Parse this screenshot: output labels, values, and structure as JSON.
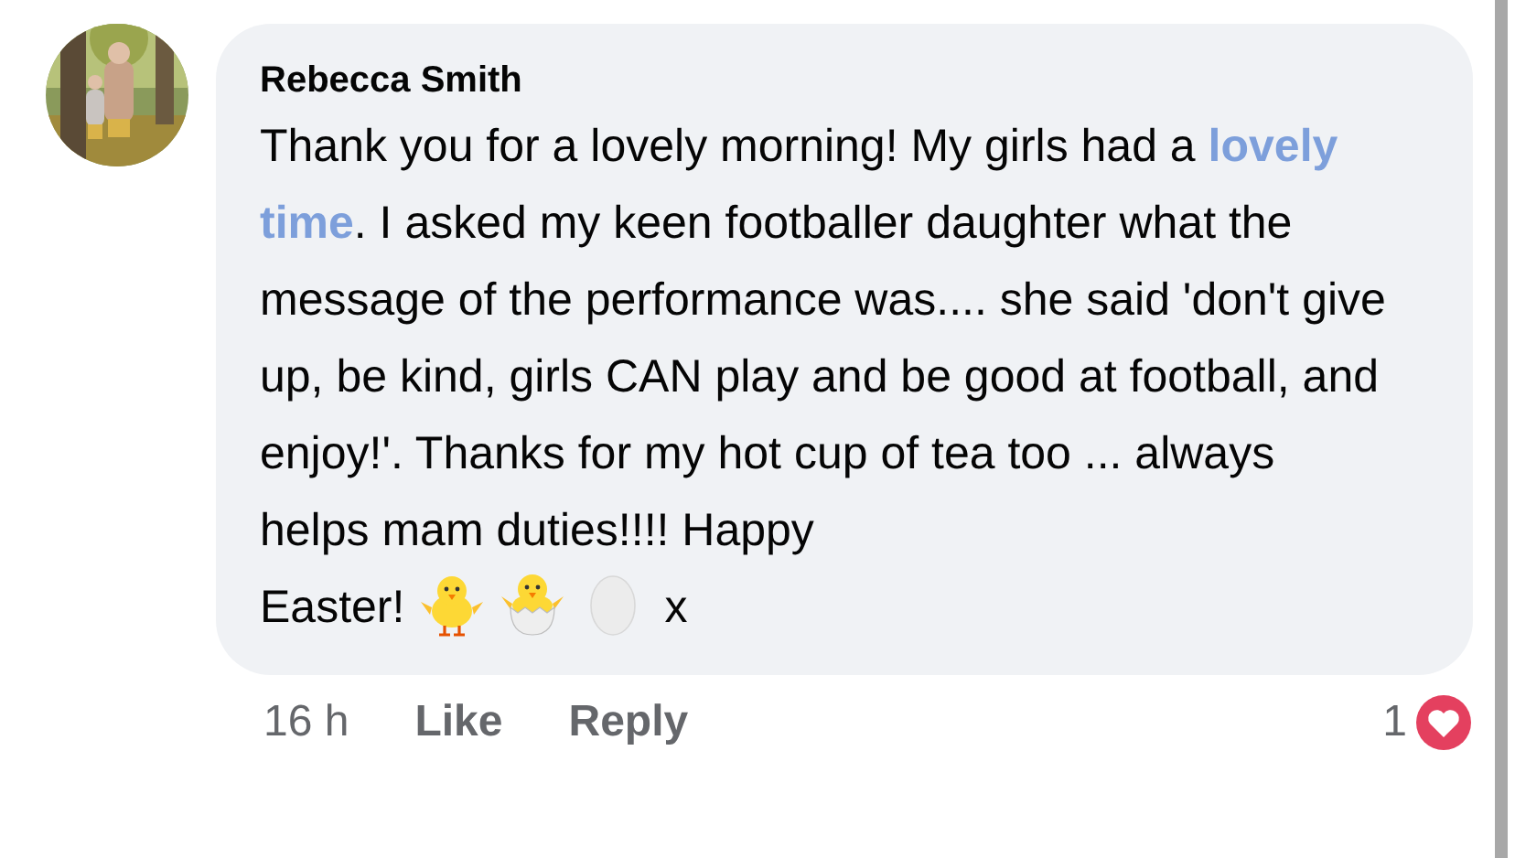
{
  "comment": {
    "author": "Rebecca Smith",
    "avatar": {
      "kind": "picture"
    },
    "body": "Thank you for a lovely morning! My girls had a **lovely time**. I asked my keen footballer daughter what the message of the performance was.... she said 'don't give up, be kind, girls CAN play and be good at football, and enjoy!'. Thanks for my hot cup of tea too ... always helps mam duties!!!! Happy",
    "last_line": "Easter!",
    "emojis": [
      {
        "kind": "chick"
      },
      {
        "kind": "hatching-chick"
      },
      {
        "kind": "egg"
      }
    ],
    "trailing": "x",
    "time": "16 h",
    "actions": [
      "Like",
      "Reply"
    ],
    "reaction_count": "1"
  }
}
